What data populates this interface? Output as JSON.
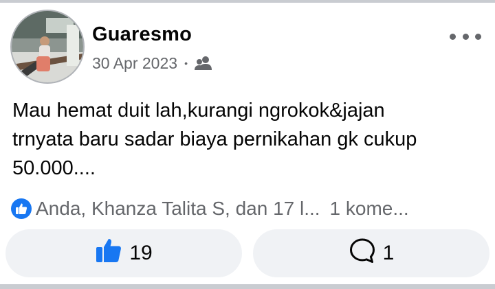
{
  "post": {
    "author": "Guaresmo",
    "date": "30 Apr 2023",
    "separator": "•",
    "audience_icon": "friends-icon",
    "text_lines": [
      "Mau hemat duit lah,kurangi ngrokok&jajan",
      "trnyata baru sadar biaya pernikahan gk cukup",
      "50.000...."
    ]
  },
  "reactions": {
    "summary": "Anda, Khanza Talita S, dan 17 l...",
    "comments_summary": "1 kome..."
  },
  "actions": {
    "like_count": "19",
    "comment_count": "1"
  },
  "colors": {
    "accent": "#1877f2",
    "button_bg": "#f0f2f5",
    "secondary_text": "#65676b",
    "divider": "#c9ccd1"
  }
}
